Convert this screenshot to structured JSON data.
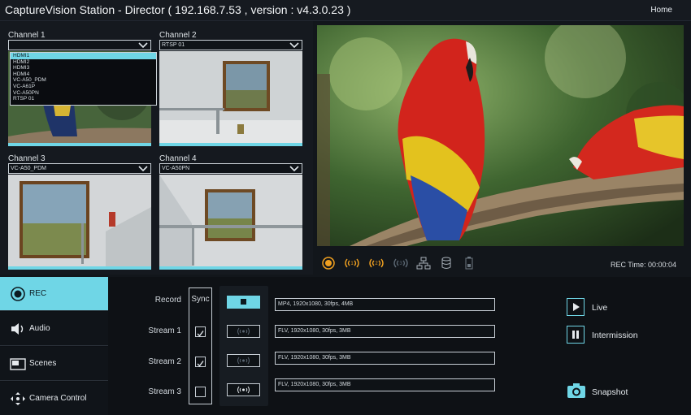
{
  "app": {
    "title": "CaptureVision Station - Director ( 192.168.7.53 , version : v4.3.0.23 )",
    "home_label": "Home"
  },
  "channels": [
    {
      "label": "Channel 1",
      "selected": ""
    },
    {
      "label": "Channel 2",
      "selected": "RTSP 01"
    },
    {
      "label": "Channel 3",
      "selected": "VC-A50_PDM"
    },
    {
      "label": "Channel 4",
      "selected": "VC-A50PN"
    }
  ],
  "dropdown_options": [
    "HDMI1",
    "HDMI2",
    "HDMI3",
    "HDMI4",
    "VC-A50_PDM",
    "VC-A61P",
    "VC-A50PN",
    "RTSP 01"
  ],
  "controls": {
    "rec_time": "REC Time: 00:00:04"
  },
  "nav": {
    "rec": "REC",
    "audio": "Audio",
    "scenes": "Scenes",
    "camera_control": "Camera Control"
  },
  "streams": {
    "sync_header": "Sync",
    "rows": [
      {
        "label": "Record",
        "info": "MP4, 1920x1080, 30fps, 4MB"
      },
      {
        "label": "Stream 1",
        "info": "FLV, 1920x1080, 30fps, 3MB",
        "sync": true
      },
      {
        "label": "Stream 2",
        "info": "FLV, 1920x1080, 30fps, 3MB",
        "sync": true
      },
      {
        "label": "Stream 3",
        "info": "FLV, 1920x1080, 30fps, 3MB",
        "sync": false
      }
    ]
  },
  "actions": {
    "live": "Live",
    "intermission": "Intermission",
    "snapshot": "Snapshot"
  },
  "colors": {
    "accent": "#6fd6e6",
    "background": "#12161b",
    "recording": "#f0a020"
  }
}
